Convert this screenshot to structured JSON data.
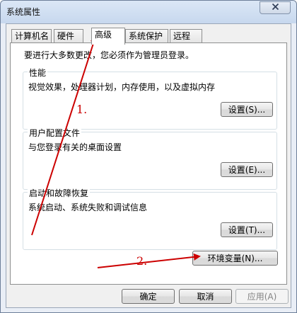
{
  "window": {
    "title": "系统属性",
    "close_icon": "close-icon"
  },
  "tabs": [
    {
      "label": "计算机名",
      "active": false
    },
    {
      "label": "硬件",
      "active": false
    },
    {
      "label": "高级",
      "active": true
    },
    {
      "label": "系统保护",
      "active": false
    },
    {
      "label": "远程",
      "active": false
    }
  ],
  "panel": {
    "admin_note": "要进行大多数更改，您必须作为管理员登录。",
    "performance": {
      "title": "性能",
      "description": "视觉效果，处理器计划，内存使用，以及虚拟内存",
      "button": "设置(S)..."
    },
    "user_profiles": {
      "title": "用户配置文件",
      "description": "与您登录有关的桌面设置",
      "button": "设置(E)..."
    },
    "startup_recovery": {
      "title": "启动和故障恢复",
      "description": "系统启动、系统失败和调试信息",
      "button": "设置(T)..."
    },
    "env_button": "环境变量(N)..."
  },
  "footer": {
    "ok": "确定",
    "cancel": "取消",
    "apply": "应用(A)"
  },
  "annotations": {
    "step1": "1.",
    "step2": "2.",
    "color": "#cc0000"
  }
}
